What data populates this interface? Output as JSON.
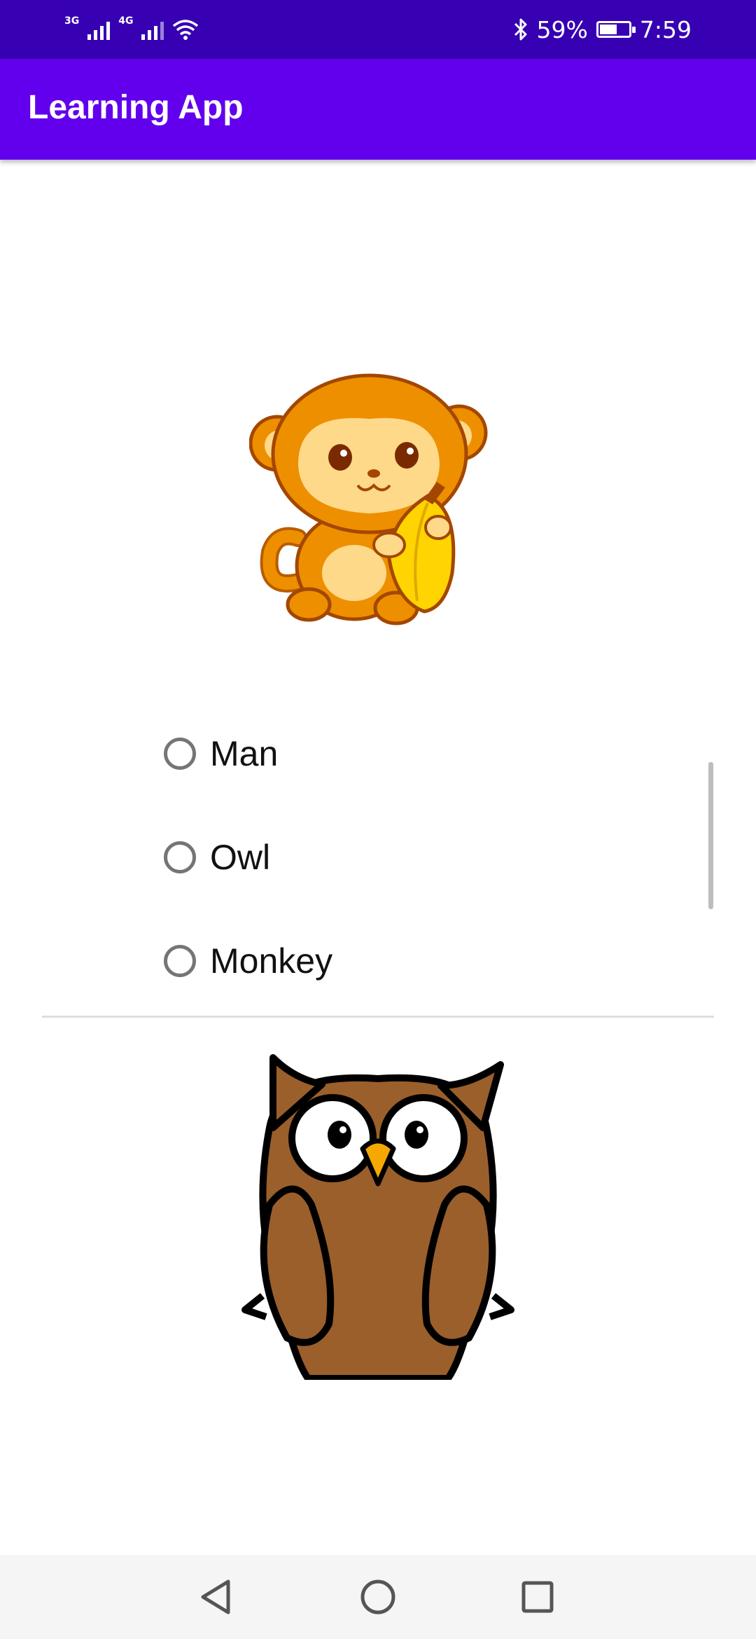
{
  "status_bar": {
    "network_1": "3G",
    "network_2": "4G",
    "battery_percent": "59%",
    "battery_level": 0.59,
    "time": "7:59",
    "icons": [
      "signal-icon",
      "signal-icon",
      "wifi-icon",
      "bluetooth-icon",
      "battery-icon"
    ]
  },
  "app_bar": {
    "title": "Learning App"
  },
  "quiz": {
    "question_image": "monkey-image",
    "options": [
      {
        "label": "Man",
        "selected": false
      },
      {
        "label": "Owl",
        "selected": false
      },
      {
        "label": "Monkey",
        "selected": false
      }
    ]
  },
  "next_item": {
    "image": "owl-image"
  },
  "nav_bar": {
    "icons": [
      "back-icon",
      "home-icon",
      "recents-icon"
    ]
  },
  "colors": {
    "status_bar": "#3700b3",
    "app_bar": "#6200ee",
    "radio_outline": "#757575"
  }
}
